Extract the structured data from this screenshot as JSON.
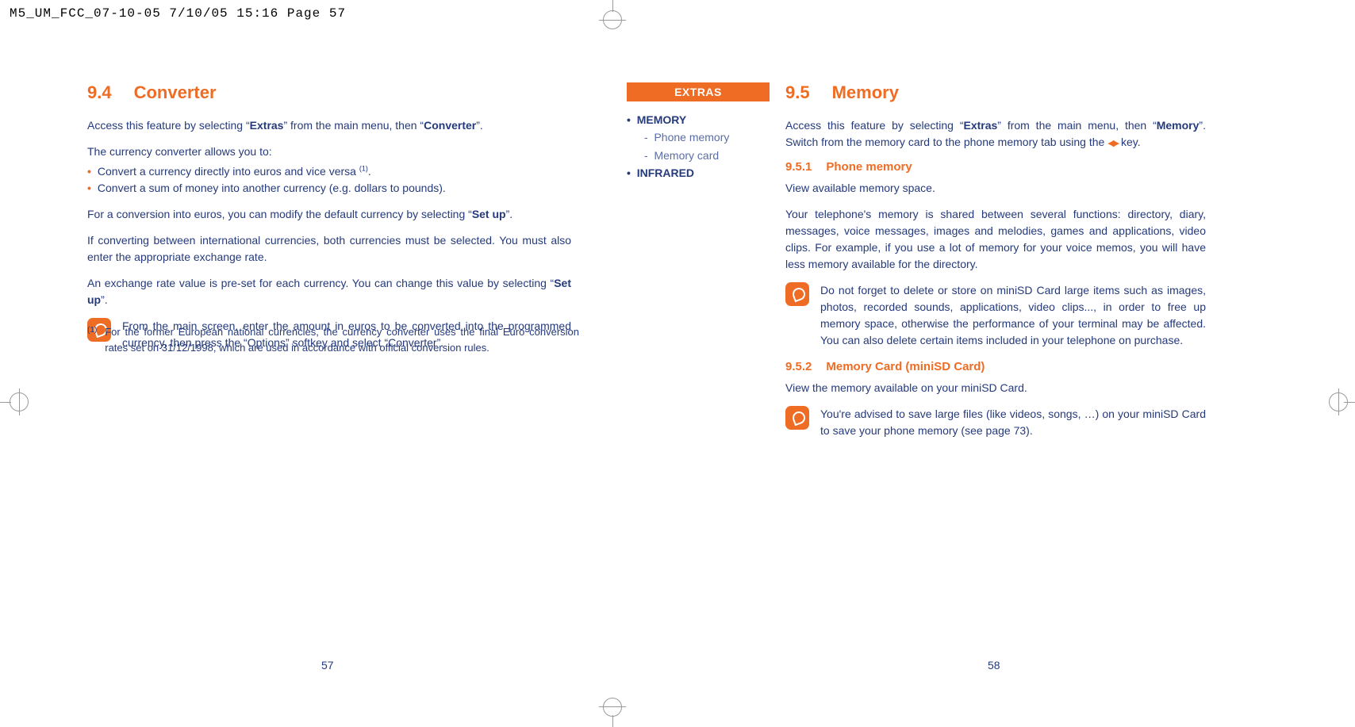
{
  "header_slug": "M5_UM_FCC_07-10-05  7/10/05  15:16  Page 57",
  "page_left_number": "57",
  "page_right_number": "58",
  "left": {
    "section_num": "9.4",
    "section_title": "Converter",
    "intro_pre": "Access this feature by selecting “",
    "intro_b1": "Extras",
    "intro_mid": "” from the main menu, then “",
    "intro_b2": "Converter",
    "intro_post": "”.",
    "allows": "The currency converter allows you to:",
    "bullet1_pre": "Convert a currency directly into euros and vice versa ",
    "bullet1_sup": "(1)",
    "bullet1_post": ".",
    "bullet2": "Convert a sum of money into another currency (e.g. dollars to pounds).",
    "para_setup_pre": "For a conversion into euros, you can modify the default currency by selecting “",
    "para_setup_b": "Set up",
    "para_setup_post": "”.",
    "para_intl": "If converting between international currencies, both currencies must be selected. You must also enter the appropriate exchange rate.",
    "para_rate_pre": "An exchange rate value is pre-set for each currency. You can change this value by selecting “",
    "para_rate_b": "Set up",
    "para_rate_post": "”.",
    "tip_pre": "From the main screen, enter the amount in euros to be converted into the programmed currency, then press the “",
    "tip_b1": "Options",
    "tip_mid": "” softkey and select “",
    "tip_b2": "Converter",
    "tip_post": "”.",
    "footnote_marker": "(1)",
    "footnote": "For the former European national currencies, the currency converter uses the final Euro conversion rates set on 31/12/1998, which are used in accordance with official conversion rules."
  },
  "sidebar": {
    "heading": "EXTRAS",
    "item1": "MEMORY",
    "item1a": "Phone memory",
    "item1b": "Memory card",
    "item2": "INFRARED"
  },
  "right": {
    "section_num": "9.5",
    "section_title": "Memory",
    "intro_pre": "Access this feature by selecting “",
    "intro_b1": "Extras",
    "intro_mid": "” from the main menu, then “",
    "intro_b2": "Memory",
    "intro_post": "”.  Switch from the memory card to the phone memory tab using the ",
    "intro_key": "◀▶",
    "intro_end": " key.",
    "sub1_num": "9.5.1",
    "sub1_title": "Phone memory",
    "sub1_p1": "View available memory space.",
    "sub1_p2": "Your telephone's memory is shared between several functions: directory, diary, messages, voice messages, images and melodies, games and applications, video clips. For example, if you use a lot of memory for your voice memos, you will have less memory available for the directory.",
    "sub1_tip": "Do not forget to delete or store on miniSD Card large items such as images, photos, recorded sounds, applications, video clips..., in order to free up memory space, otherwise the performance of your terminal may be affected. You can also delete certain items included in your telephone on purchase.",
    "sub2_num": "9.5.2",
    "sub2_title": "Memory Card (miniSD Card)",
    "sub2_p1": "View the memory available on your miniSD Card.",
    "sub2_tip": "You're advised to save large files (like videos, songs, …) on your miniSD Card to save your phone memory (see page 73)."
  }
}
